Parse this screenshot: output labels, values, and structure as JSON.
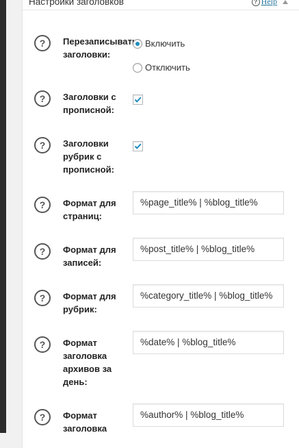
{
  "header": {
    "title": "Настройки заголовков",
    "help_label": "Help"
  },
  "settings": {
    "rewrite": {
      "label": "Перезаписывать заголовки:",
      "options": [
        "Включить",
        "Отключить"
      ],
      "selected": "Включить"
    },
    "capitalize_titles": {
      "label": "Заголовки с прописной:",
      "checked": true
    },
    "capitalize_categories": {
      "label": "Заголовки рубрик с прописной:",
      "checked": true
    },
    "page_format": {
      "label": "Формат для страниц:",
      "value": "%page_title% | %blog_title%"
    },
    "post_format": {
      "label": "Формат для записей:",
      "value": "%post_title% | %blog_title%"
    },
    "category_format": {
      "label": "Формат для рубрик:",
      "value": "%category_title% | %blog_title%"
    },
    "date_archive_format": {
      "label": "Формат заголовка архивов за день:",
      "value": "%date% | %blog_title%"
    },
    "author_archive_format": {
      "label": "Формат заголовка",
      "value": "%author% | %blog_title%"
    }
  },
  "colors": {
    "accent": "#1e8cbe",
    "link": "#21759b"
  }
}
